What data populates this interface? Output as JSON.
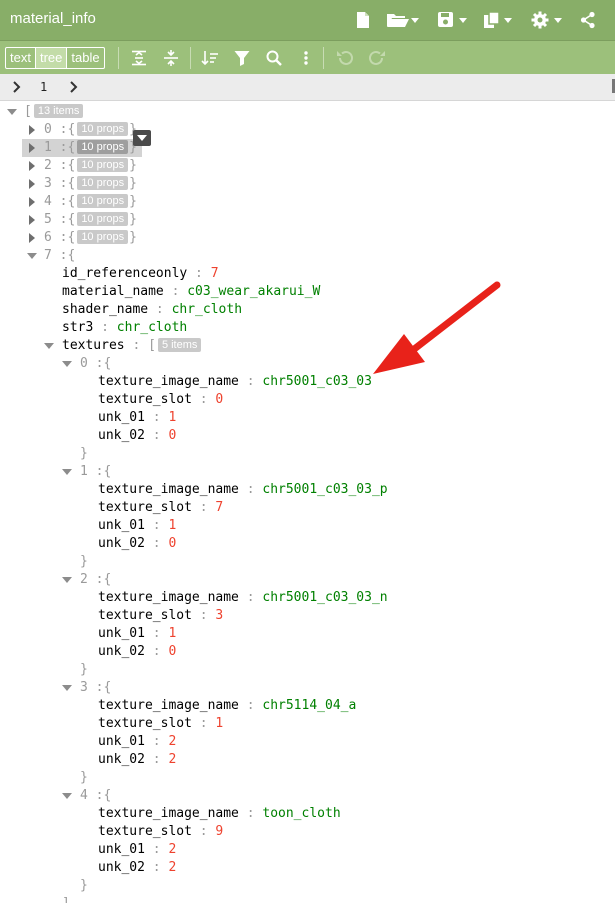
{
  "window": {
    "title": "material_info"
  },
  "toolbar": {
    "modes": [
      "text",
      "tree",
      "table"
    ],
    "active_mode": "tree"
  },
  "navbar": {
    "index": "1"
  },
  "colors": {
    "titlebar": "#88ae68",
    "toolbar": "#9cc07b",
    "string": "#008000",
    "number": "#ee422e",
    "arrow": "#e8221a"
  },
  "tree": {
    "root_brace": "[",
    "root_count": "13 items",
    "collapsed": [
      {
        "index": "0",
        "badge": "10 props"
      },
      {
        "index": "1",
        "badge": "10 props"
      },
      {
        "index": "2",
        "badge": "10 props"
      },
      {
        "index": "3",
        "badge": "10 props"
      },
      {
        "index": "4",
        "badge": "10 props"
      },
      {
        "index": "5",
        "badge": "10 props"
      },
      {
        "index": "6",
        "badge": "10 props"
      }
    ],
    "expanded_index": "7",
    "fields": [
      {
        "key": "id_referenceonly",
        "value": "7",
        "type": "num"
      },
      {
        "key": "material_name",
        "value": "c03_wear_akarui_W",
        "type": "str"
      },
      {
        "key": "shader_name",
        "value": "chr_cloth",
        "type": "str"
      },
      {
        "key": "str3",
        "value": "chr_cloth",
        "type": "str"
      }
    ],
    "textures_key": "textures",
    "textures_count": "5 items",
    "textures": [
      {
        "index": "0",
        "fields": [
          {
            "key": "texture_image_name",
            "value": "chr5001_c03_03",
            "type": "str"
          },
          {
            "key": "texture_slot",
            "value": "0",
            "type": "num"
          },
          {
            "key": "unk_01",
            "value": "1",
            "type": "num"
          },
          {
            "key": "unk_02",
            "value": "0",
            "type": "num"
          }
        ]
      },
      {
        "index": "1",
        "fields": [
          {
            "key": "texture_image_name",
            "value": "chr5001_c03_03_p",
            "type": "str"
          },
          {
            "key": "texture_slot",
            "value": "7",
            "type": "num"
          },
          {
            "key": "unk_01",
            "value": "1",
            "type": "num"
          },
          {
            "key": "unk_02",
            "value": "0",
            "type": "num"
          }
        ]
      },
      {
        "index": "2",
        "fields": [
          {
            "key": "texture_image_name",
            "value": "chr5001_c03_03_n",
            "type": "str"
          },
          {
            "key": "texture_slot",
            "value": "3",
            "type": "num"
          },
          {
            "key": "unk_01",
            "value": "1",
            "type": "num"
          },
          {
            "key": "unk_02",
            "value": "0",
            "type": "num"
          }
        ]
      },
      {
        "index": "3",
        "fields": [
          {
            "key": "texture_image_name",
            "value": "chr5114_04_a",
            "type": "str"
          },
          {
            "key": "texture_slot",
            "value": "1",
            "type": "num"
          },
          {
            "key": "unk_01",
            "value": "2",
            "type": "num"
          },
          {
            "key": "unk_02",
            "value": "2",
            "type": "num"
          }
        ]
      },
      {
        "index": "4",
        "fields": [
          {
            "key": "texture_image_name",
            "value": "toon_cloth",
            "type": "str"
          },
          {
            "key": "texture_slot",
            "value": "9",
            "type": "num"
          },
          {
            "key": "unk_01",
            "value": "2",
            "type": "num"
          },
          {
            "key": "unk_02",
            "value": "2",
            "type": "num"
          }
        ]
      }
    ],
    "selected_index": 1
  }
}
